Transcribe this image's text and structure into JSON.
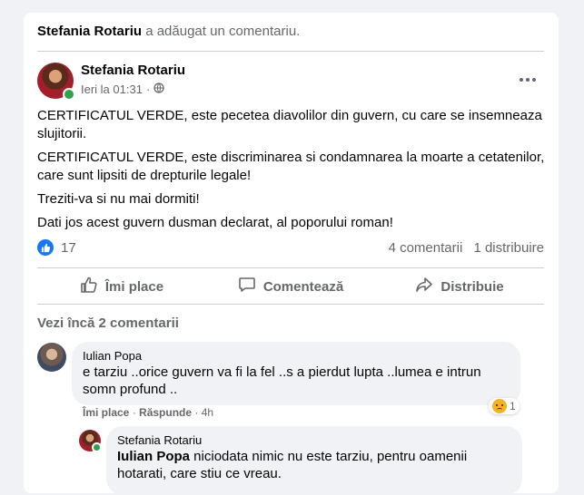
{
  "activity": {
    "actor": "Stefania Rotariu",
    "action": "a adăugat un comentariu."
  },
  "post": {
    "author": "Stefania Rotariu",
    "time": "Ieri la 01:31",
    "dot": "·",
    "paragraphs": [
      "CERTIFICATUL VERDE, este pecetea diavolilor din guvern, cu care se insemneaza slujitorii.",
      "CERTIFICATUL VERDE, este discriminarea si condamnarea la moarte a cetatenilor, care sunt lipsiti de drepturile legale!",
      "Treziti-va si nu mai dormiti!",
      "Dati jos acest guvern dusman declarat, al poporului roman!"
    ],
    "like_count": "17",
    "comments_count": "4 comentarii",
    "shares_count": "1 distribuire"
  },
  "actions": {
    "like": "Îmi place",
    "comment": "Comentează",
    "share": "Distribuie"
  },
  "comments": {
    "more_label": "Vezi încă 2 comentarii",
    "first": {
      "author": "Iulian Popa",
      "text": "e tarziu ..orice guvern va fi la fel ..s a pierdut lupta ..lumea e intrun somn profund ..",
      "like": "Îmi place",
      "reply": "Răspunde",
      "sep": "·",
      "age": "4h",
      "reaction_count": "1"
    },
    "reply": {
      "author": "Stefania Rotariu",
      "mention": "Iulian Popa",
      "text": " niciodata nimic nu este tarziu, pentru oamenii hotarati, care stiu ce vreau."
    }
  },
  "colors": {
    "accent": "#1877f2",
    "online": "#31a24c",
    "secondary_text": "#65676b",
    "background": "#f0f2f5"
  }
}
